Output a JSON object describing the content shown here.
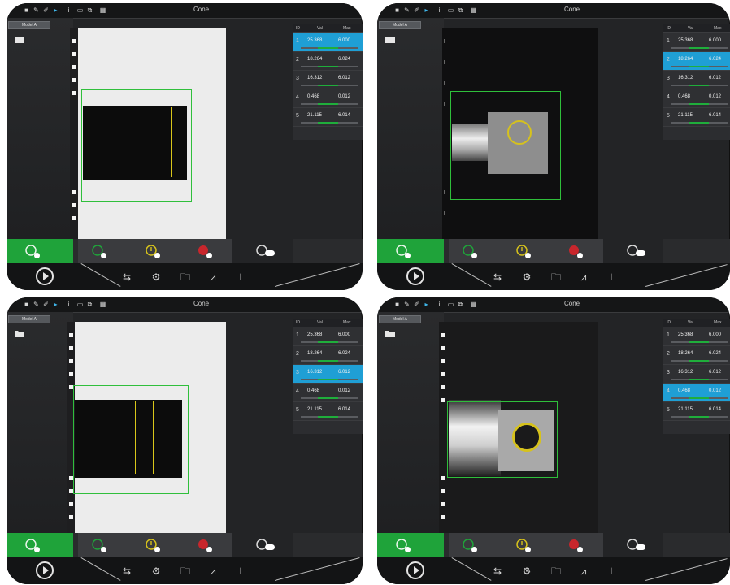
{
  "screens": [
    {
      "id": "tl",
      "title": "Cone",
      "page_chip": "Model A",
      "selected_row": 0,
      "tool_panel": {
        "headers": [
          "ID",
          "Val",
          "Max"
        ],
        "rows": [
          [
            "1",
            "25.368",
            "6.000"
          ],
          [
            "2",
            "18.264",
            "6.024"
          ],
          [
            "3",
            "16.312",
            "6.012"
          ],
          [
            "4",
            "0.468",
            "0.012"
          ],
          [
            "5",
            "21.115",
            "6.014"
          ]
        ]
      }
    },
    {
      "id": "tr",
      "title": "Cone",
      "page_chip": "Model A",
      "selected_row": 1,
      "tool_panel": {
        "headers": [
          "ID",
          "Val",
          "Max"
        ],
        "rows": [
          [
            "1",
            "25.368",
            "6.000"
          ],
          [
            "2",
            "18.264",
            "6.024"
          ],
          [
            "3",
            "16.312",
            "6.012"
          ],
          [
            "4",
            "0.468",
            "0.012"
          ],
          [
            "5",
            "21.115",
            "6.014"
          ]
        ]
      }
    },
    {
      "id": "bl",
      "title": "Cone",
      "page_chip": "Model A",
      "selected_row": 2,
      "tool_panel": {
        "headers": [
          "ID",
          "Val",
          "Max"
        ],
        "rows": [
          [
            "1",
            "25.368",
            "6.000"
          ],
          [
            "2",
            "18.264",
            "6.024"
          ],
          [
            "3",
            "16.312",
            "6.012"
          ],
          [
            "4",
            "0.468",
            "0.012"
          ],
          [
            "5",
            "21.115",
            "6.014"
          ]
        ]
      }
    },
    {
      "id": "br",
      "title": "Cone",
      "page_chip": "Model A",
      "selected_row": 3,
      "tool_panel": {
        "headers": [
          "ID",
          "Val",
          "Max"
        ],
        "rows": [
          [
            "1",
            "25.368",
            "6.000"
          ],
          [
            "2",
            "18.264",
            "6.024"
          ],
          [
            "3",
            "16.312",
            "6.012"
          ],
          [
            "4",
            "0.468",
            "0.012"
          ],
          [
            "5",
            "21.115",
            "6.014"
          ]
        ]
      }
    }
  ],
  "colors": {
    "pass": "#1fa33a",
    "warn": "#d6c21c",
    "fail": "#c8262c",
    "selected": "#1f9fd5",
    "roi": "#2fbf3b"
  },
  "icons": [
    "home-icon",
    "pen-icon",
    "brush-icon",
    "cursor-icon",
    "info-icon",
    "window-icon",
    "copy-icon",
    "grid-icon",
    "folder-icon",
    "play-icon",
    "pass-camera-icon",
    "warning-icon",
    "fail-camera-icon",
    "camera-settings-icon",
    "swap-icon",
    "gear-icon",
    "open-folder-icon",
    "signal-icon",
    "network-icon"
  ]
}
